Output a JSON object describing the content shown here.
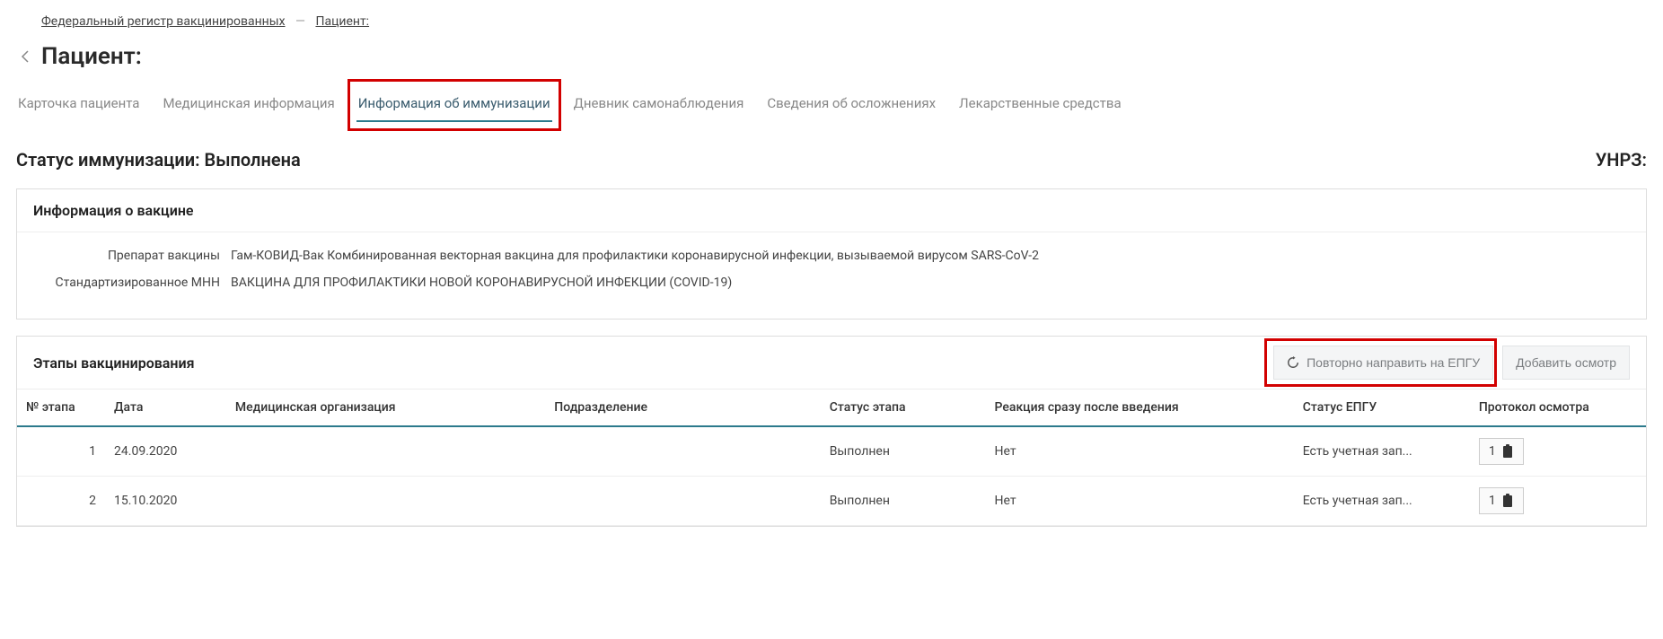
{
  "breadcrumb": {
    "item1": "Федеральный регистр вакцинированных",
    "item2": "Пациент:"
  },
  "page_title": "Пациент:",
  "tabs": [
    {
      "label": "Карточка пациента"
    },
    {
      "label": "Медицинская информация"
    },
    {
      "label": "Информация об иммунизации"
    },
    {
      "label": "Дневник самонаблюдения"
    },
    {
      "label": "Сведения об осложнениях"
    },
    {
      "label": "Лекарственные средства"
    }
  ],
  "status_row": {
    "status_label": "Статус иммунизации: Выполнена",
    "unrz": "УНРЗ:"
  },
  "vaccine_panel": {
    "header": "Информация о вакцине",
    "rows": [
      {
        "label": "Препарат вакцины",
        "value": "Гам-КОВИД-Вак Комбинированная векторная вакцина для профилактики коронавирусной инфекции, вызываемой вирусом SARS-CoV-2"
      },
      {
        "label": "Стандартизированное МНН",
        "value": "ВАКЦИНА ДЛЯ ПРОФИЛАКТИКИ НОВОЙ КОРОНАВИРУСНОЙ ИНФЕКЦИИ (COVID-19)"
      }
    ]
  },
  "stages_panel": {
    "header": "Этапы вакцинирования",
    "btn_resend": "Повторно направить на ЕПГУ",
    "btn_add": "Добавить осмотр",
    "columns": {
      "num": "№ этапа",
      "date": "Дата",
      "org": "Медицинская организация",
      "dept": "Подразделение",
      "status": "Статус этапа",
      "reaction": "Реакция сразу после введения",
      "epgu": "Статус ЕПГУ",
      "protocol": "Протокол осмотра"
    },
    "rows": [
      {
        "num": "1",
        "date": "24.09.2020",
        "org": "",
        "dept": "",
        "status": "Выполнен",
        "reaction": "Нет",
        "epgu": "Есть учетная зап...",
        "protocol": "1"
      },
      {
        "num": "2",
        "date": "15.10.2020",
        "org": "",
        "dept": "",
        "status": "Выполнен",
        "reaction": "Нет",
        "epgu": "Есть учетная зап...",
        "protocol": "1"
      }
    ]
  }
}
